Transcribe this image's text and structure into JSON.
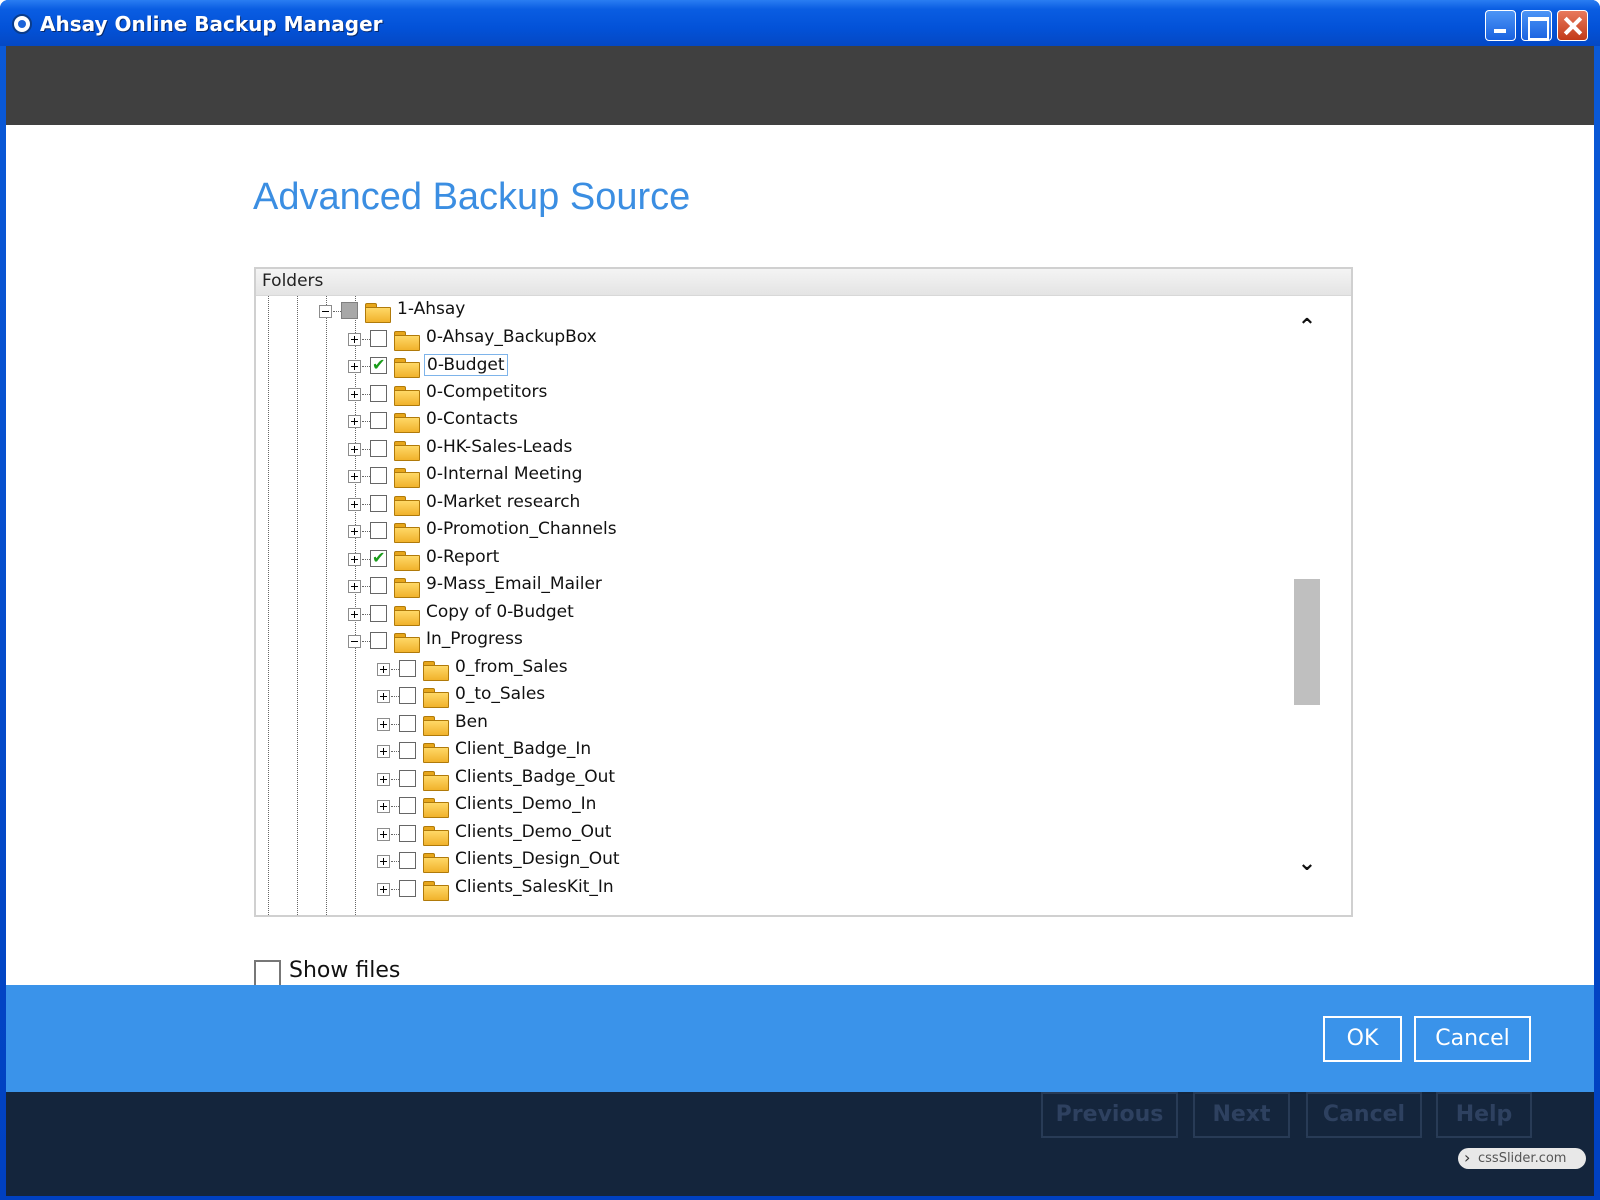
{
  "window": {
    "title": "Ahsay Online Backup Manager"
  },
  "page": {
    "title": "Advanced Backup Source"
  },
  "tree": {
    "header": "Folders",
    "nodes": [
      {
        "label": "1-Ahsay",
        "level": 0,
        "expanded": true,
        "checked": "partial"
      },
      {
        "label": "0-Ahsay_BackupBox",
        "level": 1,
        "expanded": false,
        "checked": "none"
      },
      {
        "label": "0-Budget",
        "level": 1,
        "expanded": false,
        "checked": "checked",
        "focused": true
      },
      {
        "label": "0-Competitors",
        "level": 1,
        "expanded": false,
        "checked": "none"
      },
      {
        "label": "0-Contacts",
        "level": 1,
        "expanded": false,
        "checked": "none"
      },
      {
        "label": "0-HK-Sales-Leads",
        "level": 1,
        "expanded": false,
        "checked": "none"
      },
      {
        "label": "0-Internal Meeting",
        "level": 1,
        "expanded": false,
        "checked": "none"
      },
      {
        "label": "0-Market research",
        "level": 1,
        "expanded": false,
        "checked": "none"
      },
      {
        "label": "0-Promotion_Channels",
        "level": 1,
        "expanded": false,
        "checked": "none"
      },
      {
        "label": "0-Report",
        "level": 1,
        "expanded": false,
        "checked": "checked"
      },
      {
        "label": "9-Mass_Email_Mailer",
        "level": 1,
        "expanded": false,
        "checked": "none"
      },
      {
        "label": "Copy of 0-Budget",
        "level": 1,
        "expanded": false,
        "checked": "none"
      },
      {
        "label": "In_Progress",
        "level": 1,
        "expanded": true,
        "checked": "none"
      },
      {
        "label": "0_from_Sales",
        "level": 2,
        "expanded": false,
        "checked": "none"
      },
      {
        "label": "0_to_Sales",
        "level": 2,
        "expanded": false,
        "checked": "none"
      },
      {
        "label": "Ben",
        "level": 2,
        "expanded": false,
        "checked": "none"
      },
      {
        "label": "Client_Badge_In",
        "level": 2,
        "expanded": false,
        "checked": "none"
      },
      {
        "label": "Clients_Badge_Out",
        "level": 2,
        "expanded": false,
        "checked": "none"
      },
      {
        "label": "Clients_Demo_In",
        "level": 2,
        "expanded": false,
        "checked": "none"
      },
      {
        "label": "Clients_Demo_Out",
        "level": 2,
        "expanded": false,
        "checked": "none"
      },
      {
        "label": "Clients_Design_Out",
        "level": 2,
        "expanded": false,
        "checked": "none"
      },
      {
        "label": "Clients_SalesKit_In",
        "level": 2,
        "expanded": false,
        "checked": "none"
      }
    ]
  },
  "options": {
    "show_files_label": "Show files",
    "show_files_checked": false
  },
  "dialog_buttons": {
    "ok": "OK",
    "cancel": "Cancel"
  },
  "wizard_buttons": {
    "previous": "Previous",
    "next": "Next",
    "cancel": "Cancel",
    "help": "Help"
  },
  "watermark": "cssSlider.com",
  "icons": {
    "app": "app-icon",
    "minimize": "minimize-icon",
    "maximize": "maximize-icon",
    "close": "close-icon",
    "folder": "folder-icon",
    "scroll_up": "chevron-up-icon",
    "scroll_down": "chevron-down-icon"
  },
  "colors": {
    "accent": "#3b8ee2",
    "action_bar": "#3a93ea",
    "footer": "#14253c",
    "banner": "#404040"
  }
}
